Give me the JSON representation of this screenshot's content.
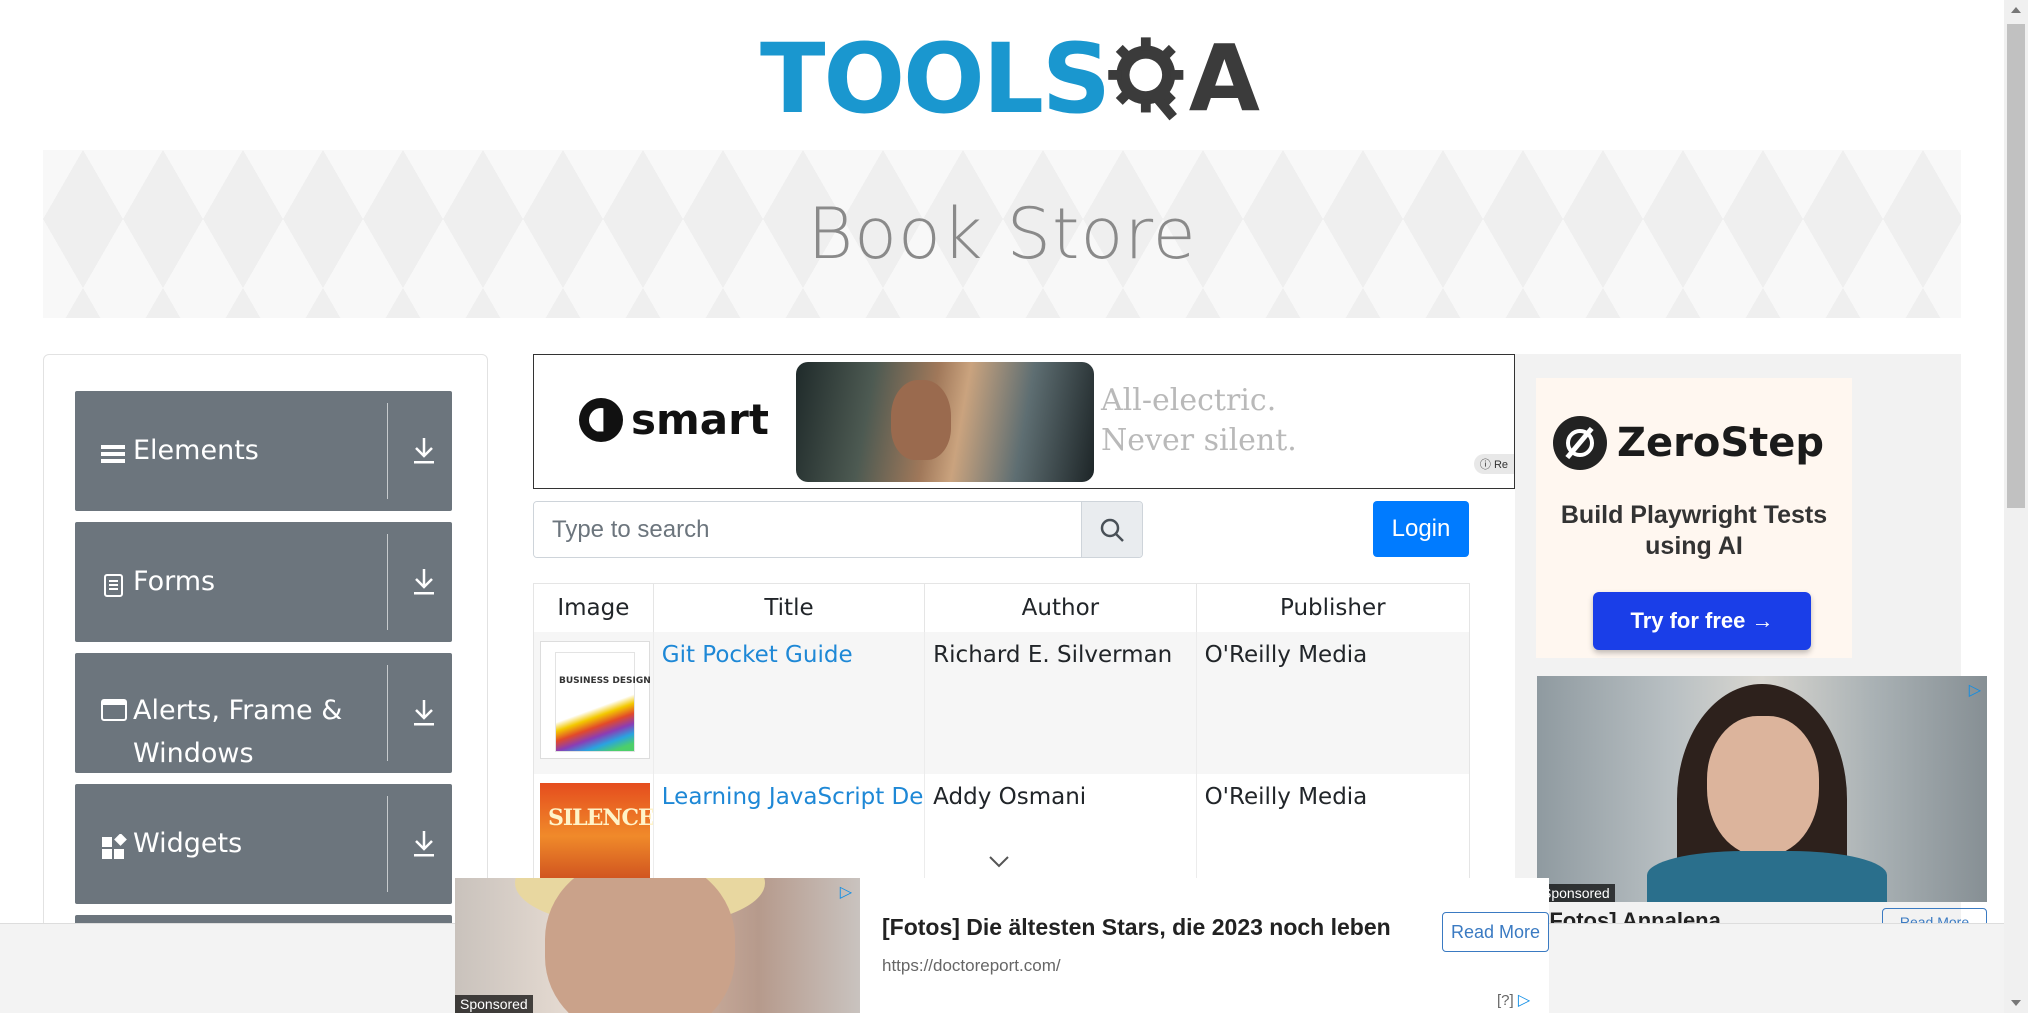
{
  "brand": {
    "logo_left": "TOOLS",
    "logo_right": "A"
  },
  "banner": {
    "title": "Book Store"
  },
  "sidebar": {
    "groups": [
      {
        "label": "Elements",
        "icon": "hamburger-icon"
      },
      {
        "label": "Forms",
        "icon": "document-icon"
      },
      {
        "label": "Alerts, Frame & Windows",
        "icon": "window-icon"
      },
      {
        "label": "Widgets",
        "icon": "widgets-icon"
      }
    ]
  },
  "top_ad": {
    "brand": "smart",
    "tagline_1": "All-electric.",
    "tagline_2": "Never silent.",
    "info": "Re"
  },
  "search": {
    "placeholder": "Type to search"
  },
  "login": {
    "label": "Login"
  },
  "table": {
    "headers": [
      "Image",
      "Title",
      "Author",
      "Publisher"
    ],
    "rows": [
      {
        "title": "Git Pocket Guide",
        "author": "Richard E. Silverman",
        "publisher": "O'Reilly Media",
        "cover_text": "BUSINESS DESIGN"
      },
      {
        "title": "Learning JavaScript Design Patterns",
        "author": "Addy Osmani",
        "publisher": "O'Reilly Media",
        "cover_text": "SILENCE"
      }
    ]
  },
  "right_ad": {
    "brand": "ZeroStep",
    "headline": "Build Playwright Tests using AI",
    "cta": "Try for free →",
    "sponsored": "Sponsored",
    "caption": "[Fotos] Annalena",
    "read_more": "Read More"
  },
  "bottom_ad": {
    "sponsored": "Sponsored",
    "title": "[Fotos] Die ältesten Stars, die 2023 noch leben",
    "url": "https://doctoreport.com/",
    "cta": "Read More",
    "help": "[?]"
  },
  "colors": {
    "accent": "#007bff",
    "sidebar_bg": "#6c757d",
    "link": "#1e88d6",
    "logo_blue": "#1a97cf"
  }
}
